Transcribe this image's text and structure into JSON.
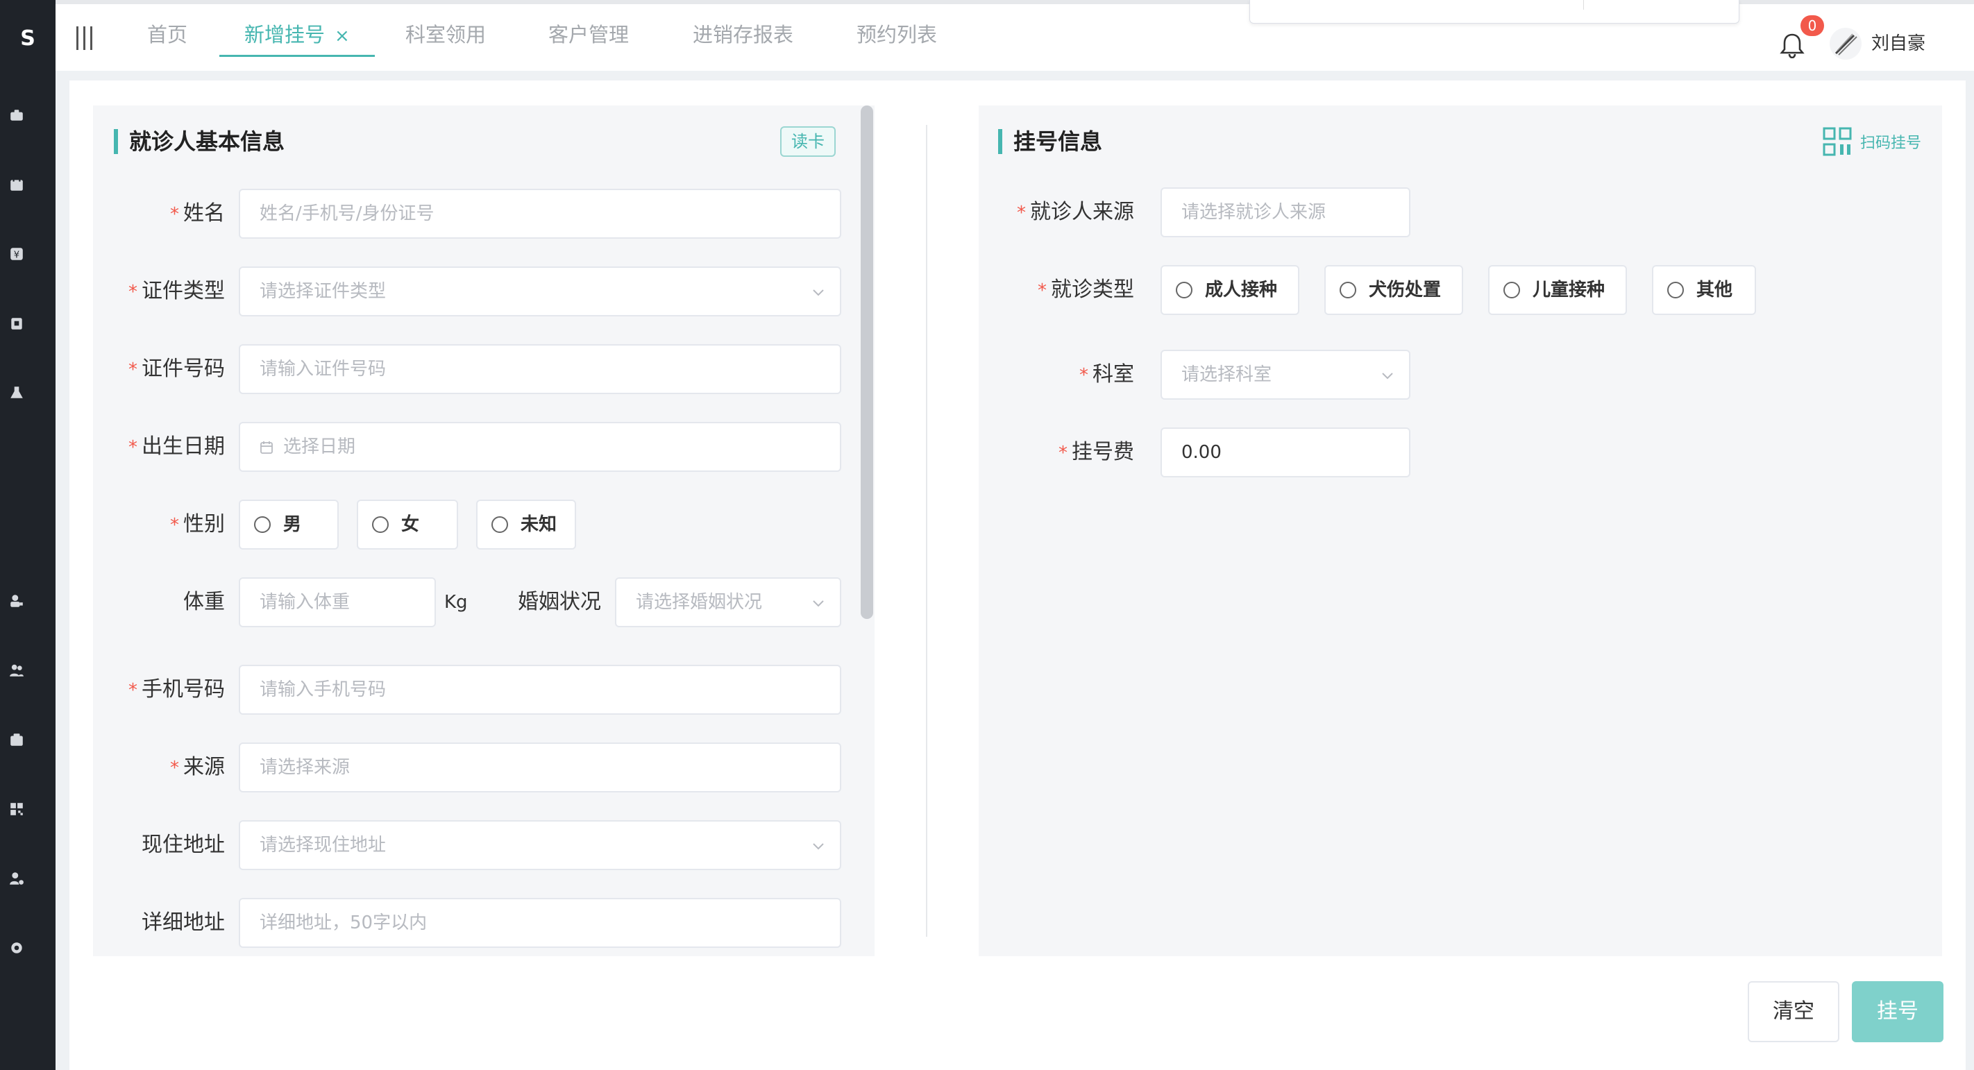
{
  "app": {
    "logo": "S",
    "accent_color": "#46b6b0"
  },
  "sidebar": {
    "icons": [
      "clinic-icon",
      "calendar-icon",
      "yen-icon",
      "inventory-icon",
      "lab-icon",
      "doctor-icon",
      "users-icon",
      "medicine-box-icon",
      "qrcode-icon",
      "user-settings-icon",
      "settings-icon"
    ]
  },
  "header": {
    "tabs": [
      {
        "label": "首页"
      },
      {
        "label": "新增挂号",
        "active": true,
        "close": "×"
      },
      {
        "label": "科室领用"
      },
      {
        "label": "客户管理"
      },
      {
        "label": "进销存报表"
      },
      {
        "label": "预约列表"
      }
    ],
    "notification_count": "0",
    "user_name": "刘自豪"
  },
  "patient": {
    "title": "就诊人基本信息",
    "read_card": "读卡",
    "required_mark": "*",
    "fields": {
      "name": {
        "label": "姓名",
        "placeholder": "姓名/手机号/身份证号"
      },
      "id_type": {
        "label": "证件类型",
        "placeholder": "请选择证件类型"
      },
      "id_number": {
        "label": "证件号码",
        "placeholder": "请输入证件号码"
      },
      "birth_date": {
        "label": "出生日期",
        "placeholder": "选择日期"
      },
      "gender": {
        "label": "性别",
        "options": [
          "男",
          "女",
          "未知"
        ]
      },
      "weight": {
        "label": "体重",
        "placeholder": "请输入体重",
        "unit": "Kg"
      },
      "marital": {
        "label": "婚姻状况",
        "placeholder": "请选择婚姻状况"
      },
      "phone": {
        "label": "手机号码",
        "placeholder": "请输入手机号码"
      },
      "source": {
        "label": "来源",
        "placeholder": "请选择来源"
      },
      "address": {
        "label": "现住地址",
        "placeholder": "请选择现住地址"
      },
      "address_detail": {
        "label": "详细地址",
        "placeholder": "详细地址，50字以内"
      }
    }
  },
  "registration": {
    "title": "挂号信息",
    "scan": "扫码挂号",
    "fields": {
      "patient_source": {
        "label": "就诊人来源",
        "placeholder": "请选择就诊人来源"
      },
      "visit_type": {
        "label": "就诊类型",
        "options": [
          "成人接种",
          "犬伤处置",
          "儿童接种",
          "其他"
        ]
      },
      "department": {
        "label": "科室",
        "placeholder": "请选择科室"
      },
      "fee": {
        "label": "挂号费",
        "value": "0.00"
      }
    }
  },
  "actions": {
    "clear": "清空",
    "register": "挂号"
  }
}
